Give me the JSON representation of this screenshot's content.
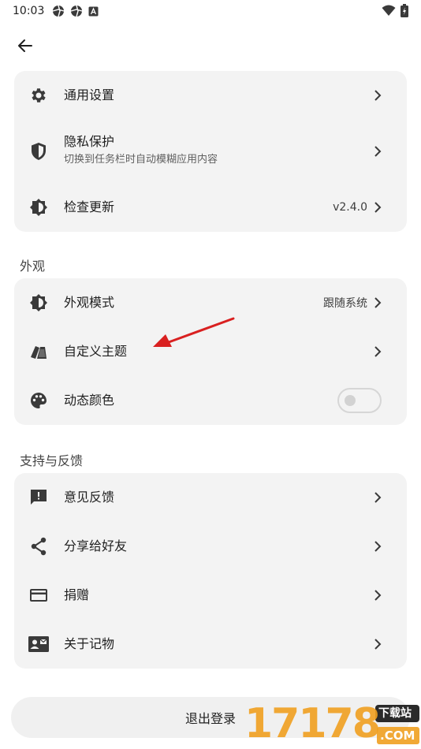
{
  "status_bar": {
    "time": "10:03"
  },
  "general": {
    "items": [
      {
        "title": "通用设置",
        "icon": "gear-icon"
      },
      {
        "title": "隐私保护",
        "subtitle": "切换到任务栏时自动模糊应用内容",
        "icon": "shield-icon"
      },
      {
        "title": "检查更新",
        "value": "v2.4.0",
        "icon": "brightness-icon"
      }
    ]
  },
  "appearance": {
    "section_label": "外观",
    "items": [
      {
        "title": "外观模式",
        "value": "跟随系统",
        "icon": "brightness-icon"
      },
      {
        "title": "自定义主题",
        "icon": "cards-icon"
      },
      {
        "title": "动态颜色",
        "icon": "palette-icon",
        "toggle_on": false
      }
    ]
  },
  "support": {
    "section_label": "支持与反馈",
    "items": [
      {
        "title": "意见反馈",
        "icon": "feedback-icon"
      },
      {
        "title": "分享给好友",
        "icon": "share-icon"
      },
      {
        "title": "捐赠",
        "icon": "card-icon"
      },
      {
        "title": "关于记物",
        "icon": "contact-icon"
      }
    ]
  },
  "logout": {
    "label": "退出登录"
  },
  "watermark": {
    "number": "17178",
    "tag": "下载站",
    "suffix": ".COM"
  },
  "colors": {
    "card_bg": "#f3f3f3",
    "annotation_arrow": "#d92020",
    "watermark_orange": "#f0a020"
  }
}
